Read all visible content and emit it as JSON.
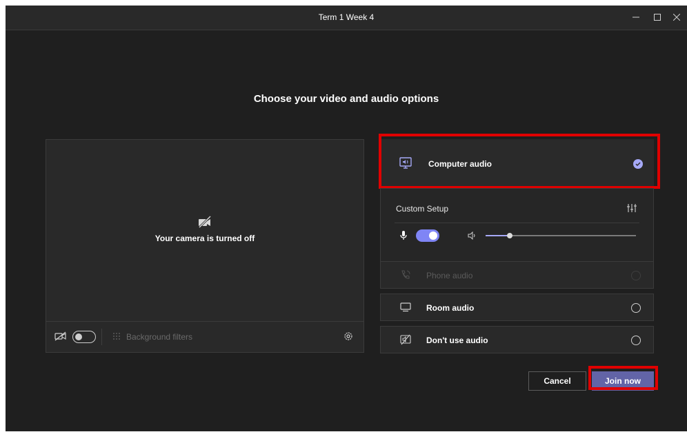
{
  "window": {
    "title": "Term 1 Week 4"
  },
  "heading": "Choose your video and audio options",
  "preview": {
    "camera_status": "Your camera is turned off",
    "camera_toggle_on": false,
    "background_filters_label": "Background filters"
  },
  "audio_options": {
    "computer_audio": {
      "label": "Computer audio",
      "selected": true
    },
    "custom_setup": {
      "label": "Custom Setup",
      "mic_on": true,
      "speaker_volume_fraction": 0.16
    },
    "phone_audio": {
      "label": "Phone audio",
      "enabled": false
    },
    "room_audio": {
      "label": "Room audio"
    },
    "no_audio": {
      "label": "Don't use audio"
    }
  },
  "actions": {
    "cancel": "Cancel",
    "join": "Join now"
  },
  "colors": {
    "accent": "#6264a7",
    "highlight": "#e00000",
    "background": "#1f1f1f"
  }
}
